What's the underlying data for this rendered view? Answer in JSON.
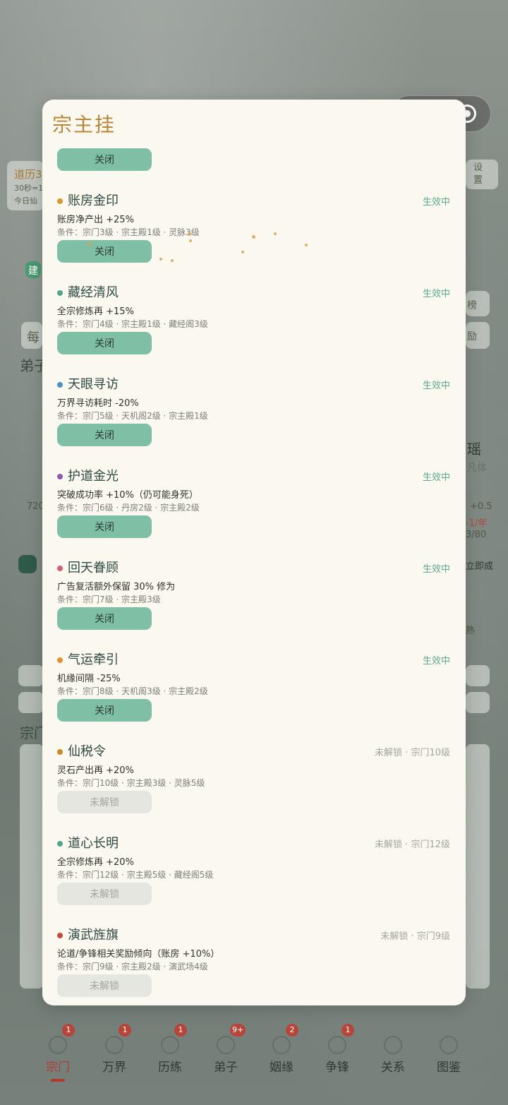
{
  "modal": {
    "title": "宗主挂",
    "top_button": "关闭",
    "items": [
      {
        "name": "账房金印",
        "status": "生效中",
        "effect": "账房净产出 +25%",
        "condition": "条件：宗门3级 · 宗主殿1级 · 灵脉3级",
        "button": "关闭",
        "dot_color": "#d9962f",
        "locked": false
      },
      {
        "name": "藏经清风",
        "status": "生效中",
        "effect": "全宗修炼再 +15%",
        "condition": "条件：宗门4级 · 宗主殿1级 · 藏经阁3级",
        "button": "关闭",
        "dot_color": "#4fa58f",
        "locked": false
      },
      {
        "name": "天眼寻访",
        "status": "生效中",
        "effect": "万界寻访耗时 -20%",
        "condition": "条件：宗门5级 · 天机阁2级 · 宗主殿1级",
        "button": "关闭",
        "dot_color": "#4b8fc4",
        "locked": false
      },
      {
        "name": "护道金光",
        "status": "生效中",
        "effect": "突破成功率 +10%（仍可能身死）",
        "condition": "条件：宗门6级 · 丹房2级 · 宗主殿2级",
        "button": "关闭",
        "dot_color": "#8b5bb0",
        "locked": false
      },
      {
        "name": "回天眷顾",
        "status": "生效中",
        "effect": "广告复活额外保留 30% 修为",
        "condition": "条件：宗门7级 · 宗主殿3级",
        "button": "关闭",
        "dot_color": "#d2607a",
        "locked": false
      },
      {
        "name": "气运牵引",
        "status": "生效中",
        "effect": "机缘间隔 -25%",
        "condition": "条件：宗门8级 · 天机阁3级 · 宗主殿2级",
        "button": "关闭",
        "dot_color": "#d9962f",
        "locked": false
      },
      {
        "name": "仙税令",
        "status": "未解锁 · 宗门10级",
        "effect": "灵石产出再 +20%",
        "condition": "条件：宗门10级 · 宗主殿3级 · 灵脉5级",
        "button": "未解锁",
        "dot_color": "#c98a2a",
        "locked": true
      },
      {
        "name": "道心长明",
        "status": "未解锁 · 宗门12级",
        "effect": "全宗修炼再 +20%",
        "condition": "条件：宗门12级 · 宗主殿5级 · 藏经阁5级",
        "button": "未解锁",
        "dot_color": "#4fa58f",
        "locked": true
      },
      {
        "name": "演武旌旗",
        "status": "未解锁 · 宗门9级",
        "effect": "论道/争锋相关奖励倾向（账房 +10%）",
        "condition": "条件：宗门9级 · 宗主殿2级 · 演武场4级",
        "button": "未解锁",
        "dot_color": "#c9483d",
        "locked": true
      }
    ]
  },
  "capsule": {
    "close_label": "关闭",
    "more_icon": "more-dots-icon",
    "target_icon": "target-icon"
  },
  "background": {
    "calendar_label": "道历3",
    "timer_label": "30秒=1",
    "today_label": "今日仙",
    "settings_label": "设置",
    "rank_label": "榜",
    "reward_label": "励",
    "disciples_label": "弟子",
    "sect_label": "宗门",
    "name_fragment": "瑶",
    "body_fragment": "凡体",
    "number_left": "720",
    "number_right": "+0.5",
    "per_year": "-1/年",
    "ratio": "3/80",
    "build_label": "建",
    "instant_label": "立即成",
    "familiar_label": "熟",
    "every_label": "每"
  },
  "nav": {
    "items": [
      {
        "label": "宗门",
        "badge": "1",
        "active": true,
        "icon": "sect-icon"
      },
      {
        "label": "万界",
        "badge": "1",
        "active": false,
        "icon": "realms-icon"
      },
      {
        "label": "历练",
        "badge": "1",
        "active": false,
        "icon": "training-icon"
      },
      {
        "label": "弟子",
        "badge": "9+",
        "active": false,
        "icon": "disciples-icon"
      },
      {
        "label": "姻缘",
        "badge": "2",
        "active": false,
        "icon": "marriage-icon"
      },
      {
        "label": "争锋",
        "badge": "1",
        "active": false,
        "icon": "contest-icon"
      },
      {
        "label": "关系",
        "badge": "",
        "active": false,
        "icon": "relations-icon"
      },
      {
        "label": "图鉴",
        "badge": "",
        "active": false,
        "icon": "codex-icon"
      }
    ]
  },
  "colors": {
    "accent": "#b8863a",
    "active_button": "#7fbfa6",
    "status_active": "#5aa88f",
    "nav_active": "#b23a2e"
  }
}
